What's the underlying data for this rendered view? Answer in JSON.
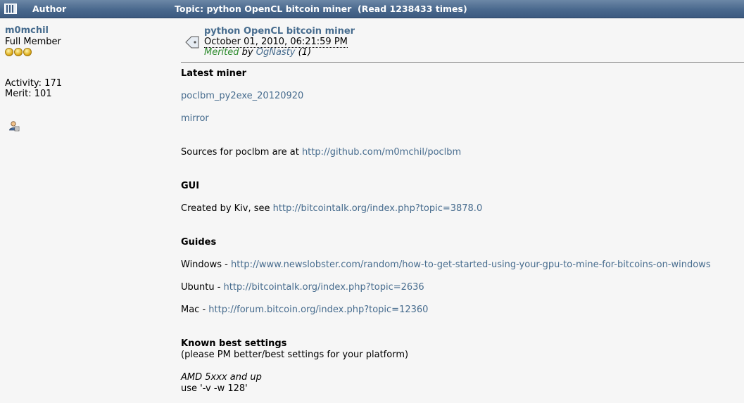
{
  "header": {
    "author_label": "Author",
    "topic_label": "Topic: python OpenCL bitcoin miner  (Read 1238433 times)"
  },
  "poster": {
    "name": "m0mchil",
    "rank": "Full Member",
    "activity": "Activity: 171",
    "merit": "Merit: 101"
  },
  "post": {
    "subject": "python OpenCL bitcoin miner",
    "date": "October 01, 2010, 06:21:59 PM",
    "merited_word": "Merited",
    "merited_by": " by ",
    "merited_user": "OgNasty",
    "merited_count": " (1)"
  },
  "content": {
    "latest_miner": "Latest miner",
    "poclbm_link": "poclbm_py2exe_20120920",
    "mirror_link": "mirror",
    "sources_text": "Sources for poclbm are at ",
    "sources_link": "http://github.com/m0mchil/poclbm",
    "gui_heading": "GUI",
    "gui_text": "Created by Kiv, see ",
    "gui_link": "http://bitcointalk.org/index.php?topic=3878.0",
    "guides_heading": "Guides",
    "windows_text": "Windows - ",
    "windows_link": "http://www.newslobster.com/random/how-to-get-started-using-your-gpu-to-mine-for-bitcoins-on-windows",
    "ubuntu_text": "Ubuntu - ",
    "ubuntu_link": "http://bitcointalk.org/index.php?topic=2636",
    "mac_text": "Mac - ",
    "mac_link": "http://forum.bitcoin.org/index.php?topic=12360",
    "settings_heading": "Known best settings",
    "settings_note": "(please PM better/best settings for your platform)",
    "amd_label": "AMD 5xxx and up",
    "amd_value": "use '-v -w 128'"
  }
}
